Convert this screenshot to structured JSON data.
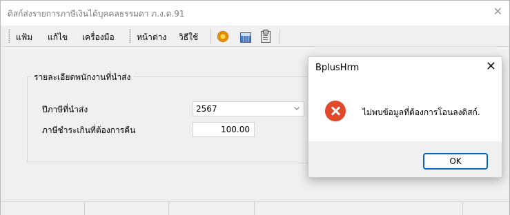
{
  "window": {
    "title": "ดิสก์ส่งรายการภาษีเงินได้บุคคลธรรมดา ภ.ง.ด.91",
    "close_glyph": "✕"
  },
  "menu": {
    "items": [
      {
        "label": "แฟ้ม"
      },
      {
        "label": "แก้ไข"
      },
      {
        "label": "เครื่องมือ"
      },
      {
        "label": "หน้าต่าง"
      },
      {
        "label": "วิธีใช้"
      }
    ],
    "toolbar_icons": [
      "tool-icon",
      "calculator-icon",
      "clipboard-icon"
    ]
  },
  "form": {
    "group_title": "รายละเอียดพนักงานที่นำส่ง",
    "year_label": "ปีภาษีที่นำส่ง",
    "year_value": "2567",
    "amount_label": "ภาษีชำระเกินที่ต้องการคืน",
    "amount_value": "100.00"
  },
  "dialog": {
    "title": "BplusHrm",
    "close_glyph": "✕",
    "message": "ไม่พบข้อมูลที่ต้องการโอนลงดิสก์.",
    "ok_label": "OK",
    "icon": "error-icon"
  },
  "colors": {
    "window_bg": "#f0f0f0",
    "error_red": "#e04a2a",
    "button_accent": "#0067c0"
  }
}
